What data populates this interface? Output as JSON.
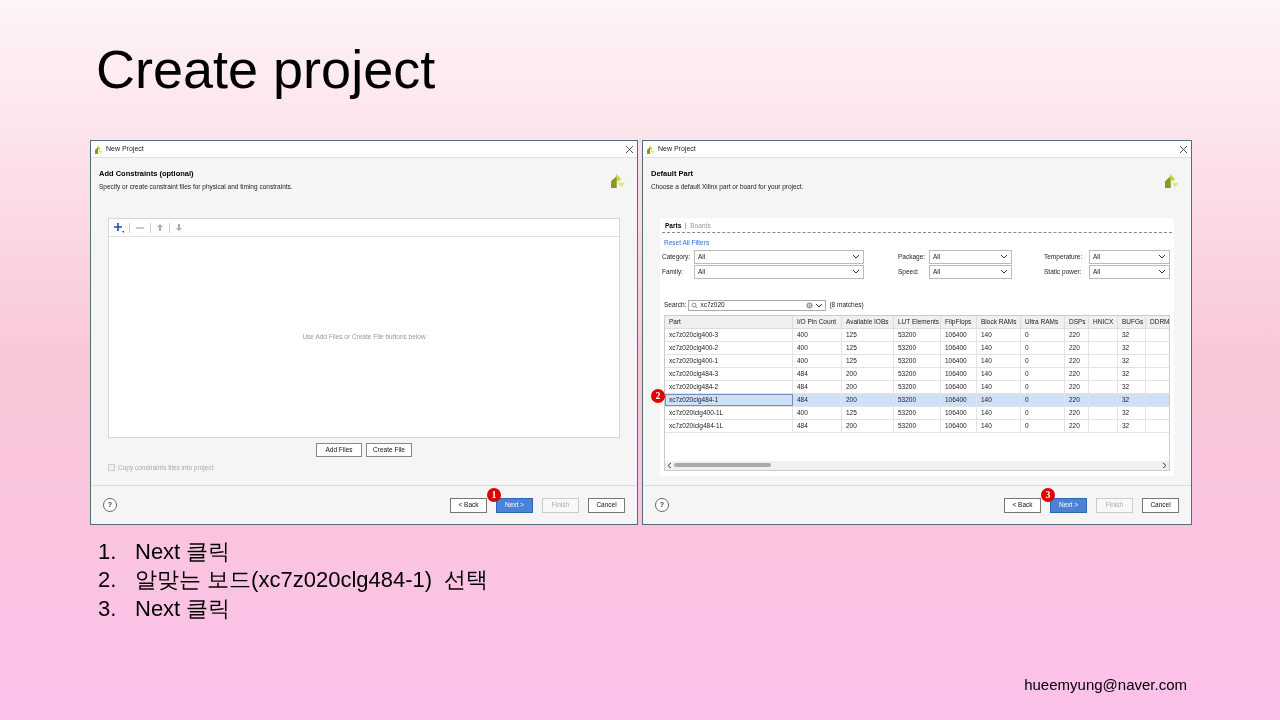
{
  "slide": {
    "title": "Create project",
    "email": "hueemyung@naver.com"
  },
  "constraints_dialog": {
    "window_title": "New Project",
    "heading": "Add Constraints (optional)",
    "subheading": "Specify or create constraint files for physical and timing constraints.",
    "empty_message": "Use Add Files or Create File buttons below",
    "buttons": [
      "Add Files",
      "Create File"
    ],
    "copy_checkbox": {
      "label": "Copy constraints files into project",
      "checked": false,
      "disabled": true
    },
    "help": "?",
    "footer_buttons": [
      {
        "label": "< Back",
        "kind": "normal"
      },
      {
        "label": "Next >",
        "kind": "primary",
        "badge": "1"
      },
      {
        "label": "Finish",
        "kind": "disabled"
      },
      {
        "label": "Cancel",
        "kind": "normal"
      }
    ]
  },
  "part_dialog": {
    "window_title": "New Project",
    "heading": "Default Part",
    "subheading": "Choose a default Xilinx part or board for your project.",
    "tabs": [
      {
        "label": "Parts",
        "selected": true
      },
      {
        "label": "Boards",
        "selected": false
      }
    ],
    "reset_link": "Reset All Filters",
    "filters": [
      {
        "label": "Category:",
        "value": "All"
      },
      {
        "label": "Package:",
        "value": "All"
      },
      {
        "label": "Temperature:",
        "value": "All"
      },
      {
        "label": "Family:",
        "value": "All"
      },
      {
        "label": "Speed:",
        "value": "All"
      },
      {
        "label": "Static power:",
        "value": "All"
      }
    ],
    "search": {
      "label": "Search:",
      "value": "xc7z020",
      "matches": "(8 matches)"
    },
    "table": {
      "columns": [
        "Part",
        "I/O Pin Count",
        "Available IOBs",
        "LUT Elements",
        "FlipFlops",
        "Block RAMs",
        "Ultra RAMs",
        "DSPs",
        "HNICX",
        "BUFGs",
        "DDRM"
      ],
      "rows": [
        {
          "cells": [
            "xc7z020clg400-3",
            "400",
            "125",
            "53200",
            "106400",
            "140",
            "0",
            "220",
            null,
            "32"
          ],
          "selected": false
        },
        {
          "cells": [
            "xc7z020clg400-2",
            "400",
            "125",
            "53200",
            "106400",
            "140",
            "0",
            "220",
            null,
            "32"
          ],
          "selected": false
        },
        {
          "cells": [
            "xc7z020clg400-1",
            "400",
            "125",
            "53200",
            "106400",
            "140",
            "0",
            "220",
            null,
            "32"
          ],
          "selected": false
        },
        {
          "cells": [
            "xc7z020clg484-3",
            "484",
            "200",
            "53200",
            "106400",
            "140",
            "0",
            "220",
            null,
            "32"
          ],
          "selected": false
        },
        {
          "cells": [
            "xc7z020clg484-2",
            "484",
            "200",
            "53200",
            "106400",
            "140",
            "0",
            "220",
            null,
            "32"
          ],
          "selected": false
        },
        {
          "cells": [
            "xc7z020clg484-1",
            "484",
            "200",
            "53200",
            "106400",
            "140",
            "0",
            "220",
            null,
            "32"
          ],
          "selected": true,
          "badge": "2"
        },
        {
          "cells": [
            "xc7z020iclg400-1L",
            "400",
            "125",
            "53200",
            "106400",
            "140",
            "0",
            "220",
            null,
            "32"
          ],
          "selected": false
        },
        {
          "cells": [
            "xc7z020iclg484-1L",
            "484",
            "200",
            "53200",
            "106400",
            "140",
            "0",
            "220",
            null,
            "32"
          ],
          "selected": false
        }
      ]
    },
    "help": "?",
    "footer_buttons": [
      {
        "label": "< Back",
        "kind": "normal"
      },
      {
        "label": "Next >",
        "kind": "primary",
        "badge": "3"
      },
      {
        "label": "Finish",
        "kind": "disabled"
      },
      {
        "label": "Cancel",
        "kind": "normal"
      }
    ]
  },
  "steps": [
    {
      "number": "1.",
      "text": "Next 클릭"
    },
    {
      "number": "2.",
      "text": "알맞는 보드(xc7z020clg484-1)  선택"
    },
    {
      "number": "3.",
      "text": "Next 클릭"
    }
  ]
}
